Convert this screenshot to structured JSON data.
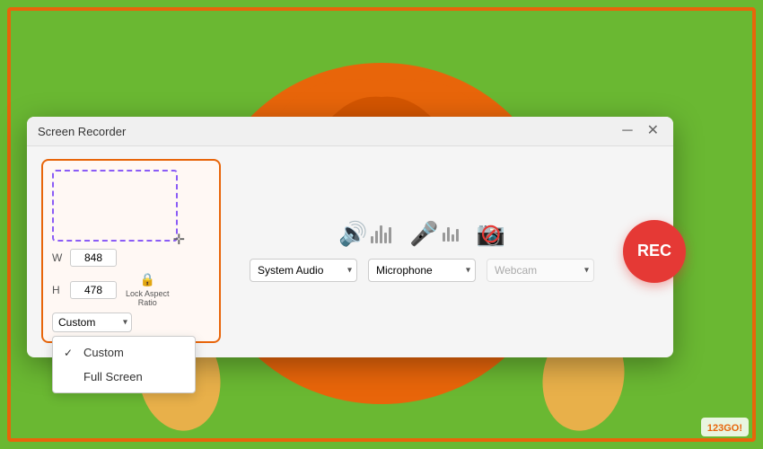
{
  "background": {
    "color": "#6ab832"
  },
  "dialog": {
    "title": "Screen Recorder",
    "minimize_label": "─",
    "close_label": "✕"
  },
  "recording_area": {
    "width_label": "W",
    "height_label": "H",
    "width_value": "848",
    "height_value": "478",
    "dropdown_selected": "Custom",
    "lock_aspect_label": "Lock Aspect\nRatio",
    "dropdown_options": [
      "Custom",
      "Full Screen"
    ]
  },
  "dropdown_menu": {
    "items": [
      {
        "label": "Custom",
        "checked": true
      },
      {
        "label": "Full Screen",
        "checked": false
      }
    ]
  },
  "audio": {
    "system_audio_label": "System Audio",
    "microphone_label": "Microphone",
    "webcam_label": "Webcam"
  },
  "rec_button": {
    "label": "REC"
  },
  "logo": {
    "text": "123GO!"
  }
}
